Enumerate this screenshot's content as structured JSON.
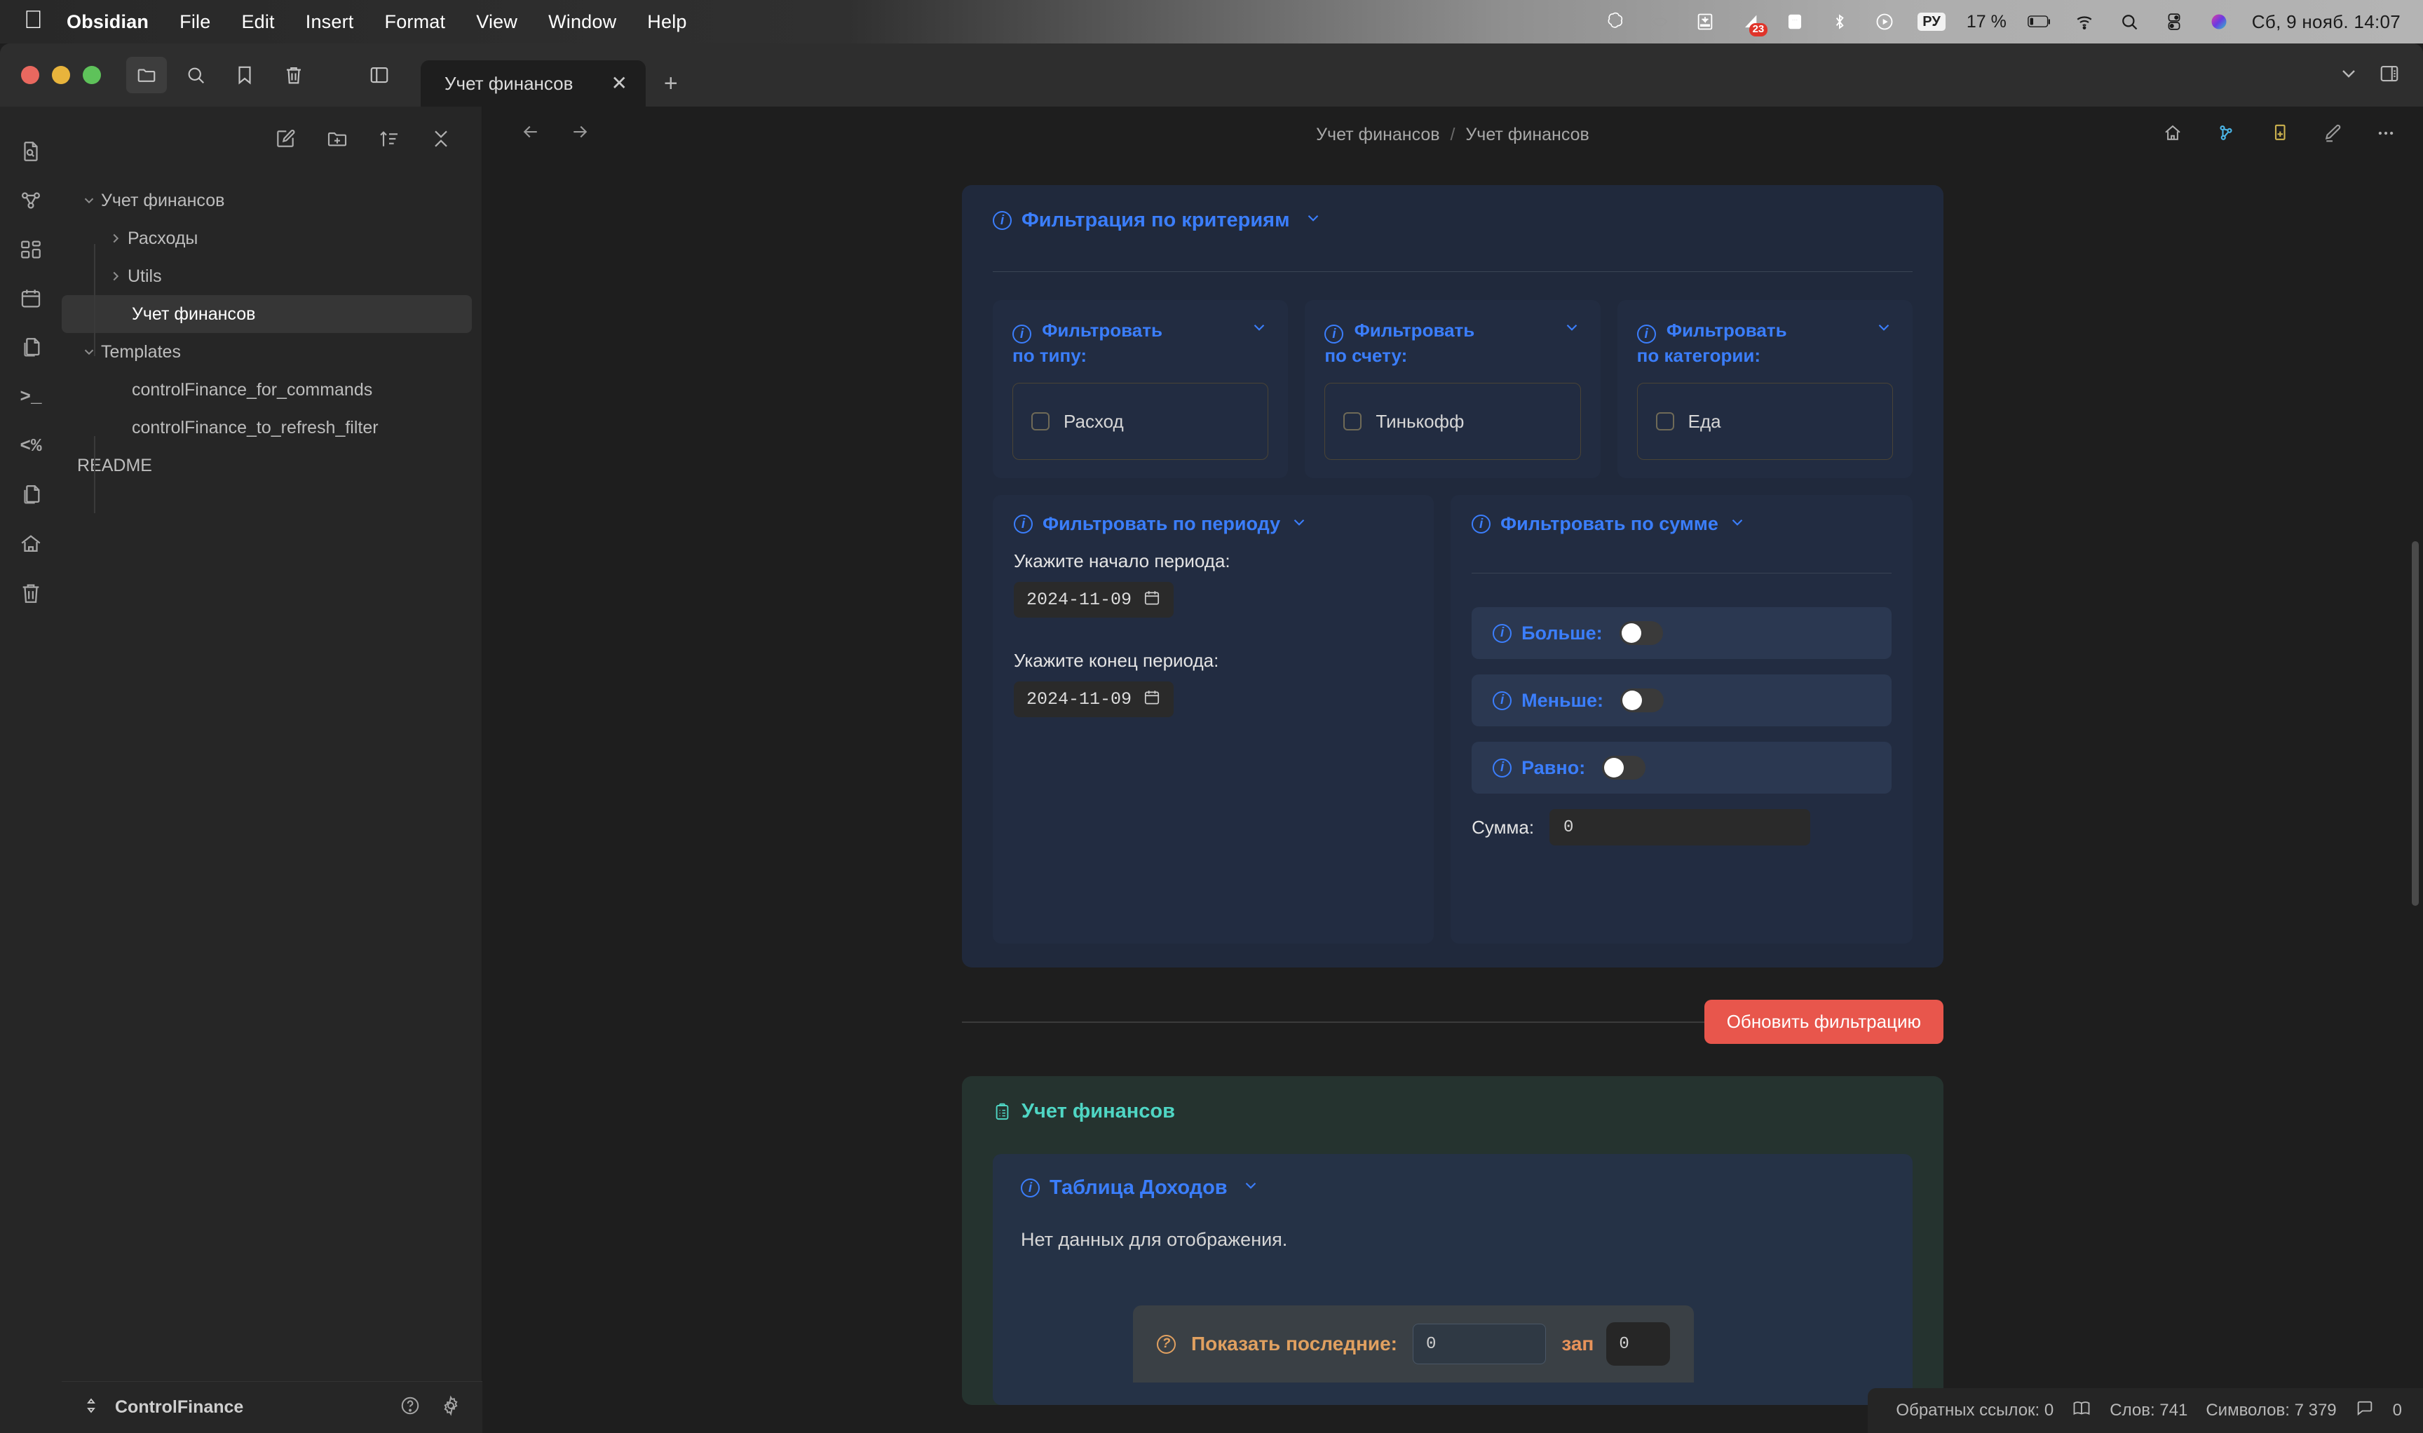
{
  "macos": {
    "app_name": "Obsidian",
    "menus": [
      "File",
      "Edit",
      "Insert",
      "Format",
      "View",
      "Window",
      "Help"
    ],
    "status": {
      "notification_badge": "23",
      "keyboard_layout": "РУ",
      "battery_percent": "17 %",
      "clock": "Сб, 9 нояб.  14:07"
    },
    "status_icons": [
      "openai-icon",
      "dimmed-app-icon",
      "screen-icon",
      "signal-icon",
      "memory-icon",
      "bluetooth-icon",
      "play-circle-icon",
      "keyboard-layout-icon",
      "battery-icon",
      "wifi-icon",
      "search-icon",
      "control-center-icon",
      "siri-icon"
    ]
  },
  "titlebar": {
    "icons": [
      "folder-icon",
      "search-icon",
      "bookmark-icon",
      "trash-icon",
      "toggle-left-sidebar-icon"
    ],
    "right_icons": [
      "chevron-down-icon",
      "toggle-right-sidebar-icon"
    ],
    "tab": {
      "label": "Учет финансов",
      "close": "✕",
      "new_tab": "+"
    }
  },
  "ribbon": {
    "items": [
      {
        "name": "file-search-icon"
      },
      {
        "name": "graph-view-icon"
      },
      {
        "name": "dashboard-icon"
      },
      {
        "name": "calendar-icon"
      },
      {
        "name": "copy-files-icon"
      },
      {
        "name": "terminal-icon",
        "glyph": ">_"
      },
      {
        "name": "templater-icon",
        "glyph": "<%"
      },
      {
        "name": "duplicate-files-icon"
      },
      {
        "name": "home-icon"
      },
      {
        "name": "trash-icon"
      }
    ]
  },
  "explorer": {
    "toolbar_icons": [
      "new-note-icon",
      "new-folder-icon",
      "sort-icon",
      "collapse-all-icon"
    ],
    "tree": [
      {
        "label": "Учет финансов",
        "type": "folder",
        "depth": 0,
        "expanded": true,
        "selected": false
      },
      {
        "label": "Расходы",
        "type": "folder",
        "depth": 1,
        "expanded": false,
        "selected": false
      },
      {
        "label": "Utils",
        "type": "folder",
        "depth": 1,
        "expanded": false,
        "selected": false
      },
      {
        "label": "Учет финансов",
        "type": "file",
        "depth": 1,
        "expanded": null,
        "selected": true
      },
      {
        "label": "Templates",
        "type": "folder",
        "depth": 0,
        "expanded": true,
        "selected": false
      },
      {
        "label": "controlFinance_for_commands",
        "type": "file",
        "depth": 1,
        "expanded": null,
        "selected": false
      },
      {
        "label": "controlFinance_to_refresh_filter",
        "type": "file",
        "depth": 1,
        "expanded": null,
        "selected": false
      },
      {
        "label": "README",
        "type": "file",
        "depth": 0,
        "expanded": null,
        "selected": false
      }
    ],
    "vault": {
      "name": "ControlFinance",
      "icons": [
        "vault-switcher-icon",
        "help-icon",
        "settings-gear-icon"
      ]
    }
  },
  "note": {
    "breadcrumb_parent": "Учет финансов",
    "breadcrumb_current": "Учет финансов",
    "nav_icons": [
      "back-arrow-icon",
      "forward-arrow-icon"
    ],
    "header_icons": [
      "home-icon",
      "graph-icon",
      "add-copy-icon",
      "edit-pencil-icon",
      "more-options-icon"
    ]
  },
  "filter": {
    "title": "Фильтрация по критериям",
    "cards": [
      {
        "title_line1": "Фильтровать",
        "title_line2": "по типу:",
        "option": "Расход",
        "checked": false
      },
      {
        "title_line1": "Фильтровать",
        "title_line2": "по счету:",
        "option": "Тинькофф",
        "checked": false
      },
      {
        "title_line1": "Фильтровать",
        "title_line2": "по категории:",
        "option": "Еда",
        "checked": false
      }
    ],
    "period": {
      "title": "Фильтровать по периоду",
      "start_label": "Укажите начало периода:",
      "start_value": "2024-11-09",
      "end_label": "Укажите конец периода:",
      "end_value": "2024-11-09"
    },
    "amount": {
      "title": "Фильтровать по сумме",
      "toggles": [
        {
          "label": "Больше:",
          "on": false
        },
        {
          "label": "Меньше:",
          "on": false
        },
        {
          "label": "Равно:",
          "on": false
        }
      ],
      "sum_label": "Сумма:",
      "sum_value": "0"
    },
    "refresh_button": "Обновить фильтрацию",
    "accent_color": "#e8564c"
  },
  "records": {
    "title": "Учет финансов",
    "table_title": "Таблица Доходов",
    "empty_message": "Нет данных для отображения.",
    "last_n_label": "Показать последние:",
    "last_n_value": "0",
    "last_n_suffix": "зап",
    "last_n_extra": "0"
  },
  "statusbar": {
    "backlinks": "Обратных ссылок: 0",
    "words": "Слов: 741",
    "chars": "Символов: 7 379",
    "comments": "0",
    "icons": [
      "book-icon",
      "comment-icon"
    ]
  }
}
